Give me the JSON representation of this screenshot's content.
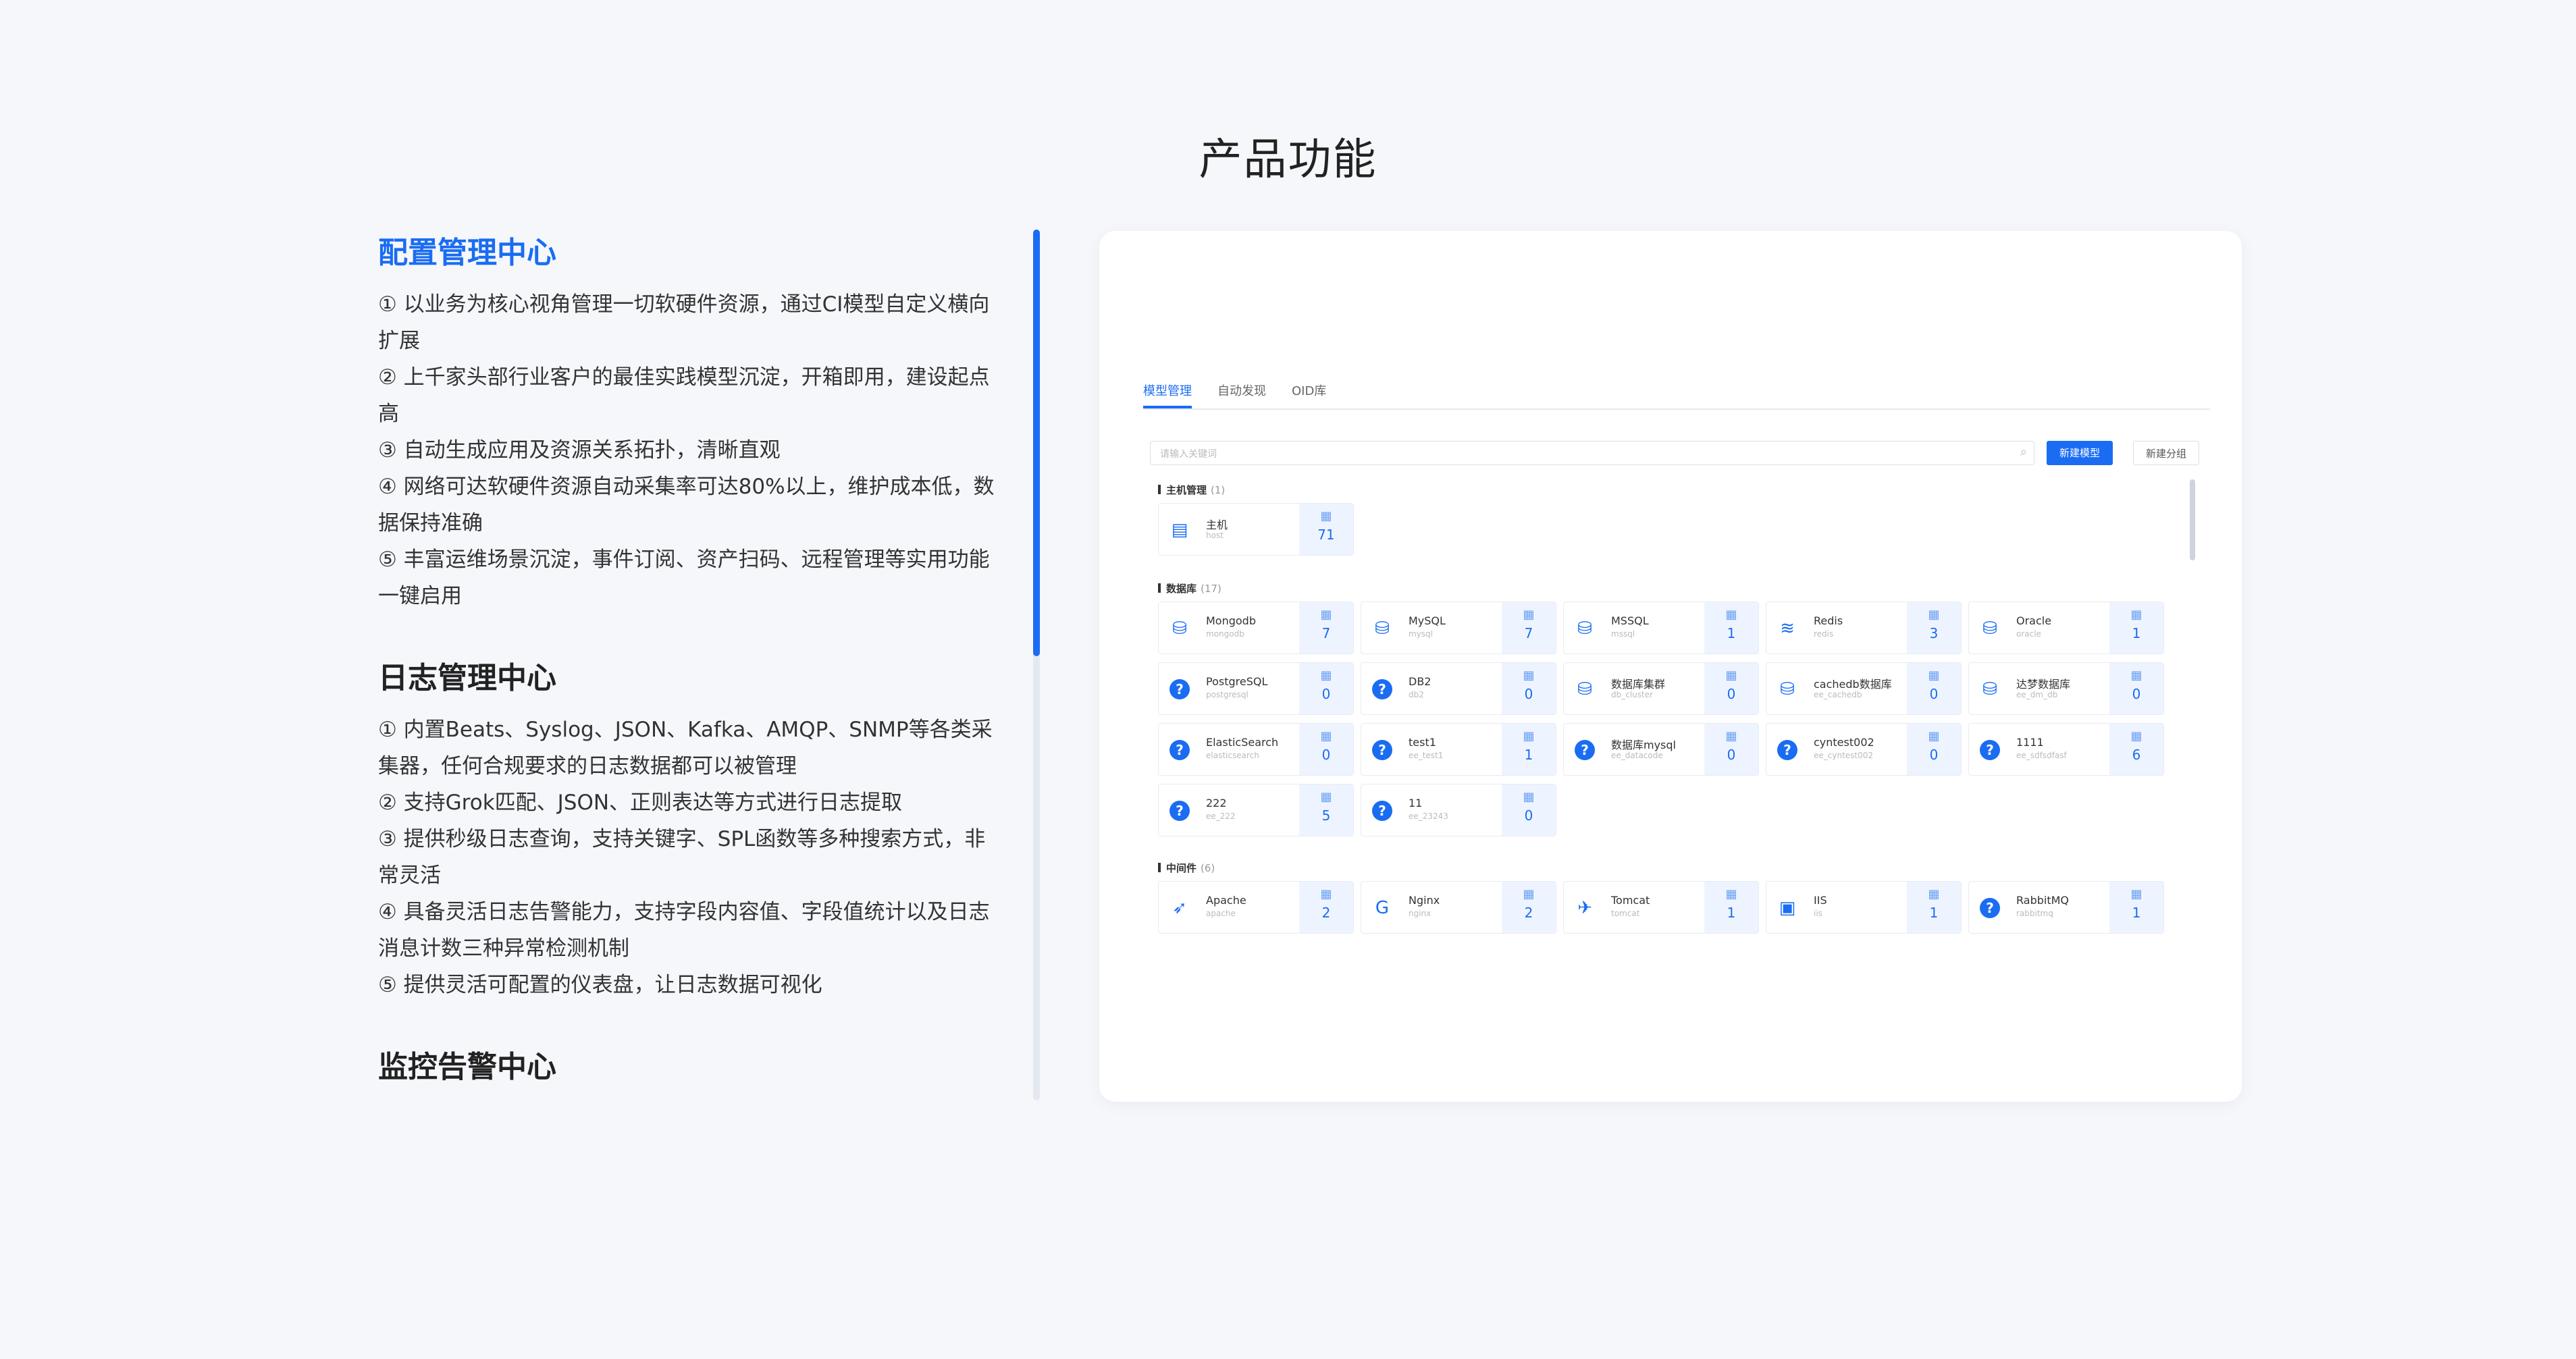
{
  "page": {
    "title": "产品功能"
  },
  "sections": [
    {
      "title": "配置管理中心",
      "lines": [
        "① 以业务为核心视角管理一切软硬件资源，通过CI模型自定义横向",
        "扩展",
        "② 上千家头部行业客户的最佳实践模型沉淀，开箱即用，建设起点",
        "高",
        "③ 自动生成应用及资源关系拓扑，清晰直观",
        "④ 网络可达软硬件资源自动采集率可达80%以上，维护成本低，数",
        "据保持准确",
        "⑤ 丰富运维场景沉淀，事件订阅、资产扫码、远程管理等实用功能",
        "一键启用"
      ]
    },
    {
      "title": "日志管理中心",
      "lines": [
        "① 内置Beats、Syslog、JSON、Kafka、AMQP、SNMP等各类采",
        "集器，任何合规要求的日志数据都可以被管理",
        "② 支持Grok匹配、JSON、正则表达等方式进行日志提取",
        "③ 提供秒级日志查询，支持关键字、SPL函数等多种搜索方式，非",
        "常灵活",
        "④ 具备灵活日志告警能力，支持字段内容值、字段值统计以及日志",
        "消息计数三种异常检测机制",
        "⑤ 提供灵活可配置的仪表盘，让日志数据可视化"
      ]
    },
    {
      "title": "监控告警中心",
      "lines": []
    }
  ],
  "tabs": [
    "模型管理",
    "自动发现",
    "OID库"
  ],
  "search": {
    "placeholder": "请输入关键词"
  },
  "buttons": {
    "new_model": "新建模型",
    "new_group": "新建分组"
  },
  "groups": [
    {
      "name": "主机管理",
      "count": "(1)",
      "items": [
        {
          "name": "主机",
          "sub": "host",
          "n": "71",
          "icon": "server-icon"
        }
      ]
    },
    {
      "name": "数据库",
      "count": "(17)",
      "items": [
        {
          "name": "Mongodb",
          "sub": "mongodb",
          "n": "7",
          "icon": "database-icon"
        },
        {
          "name": "MySQL",
          "sub": "mysql",
          "n": "7",
          "icon": "database-icon"
        },
        {
          "name": "MSSQL",
          "sub": "mssql",
          "n": "1",
          "icon": "database-icon"
        },
        {
          "name": "Redis",
          "sub": "redis",
          "n": "3",
          "icon": "layers-icon"
        },
        {
          "name": "Oracle",
          "sub": "oracle",
          "n": "1",
          "icon": "database-icon"
        },
        {
          "name": "PostgreSQL",
          "sub": "postgresql",
          "n": "0",
          "icon": "question-icon"
        },
        {
          "name": "DB2",
          "sub": "db2",
          "n": "0",
          "icon": "question-icon"
        },
        {
          "name": "数据库集群",
          "sub": "db_cluster",
          "n": "0",
          "icon": "database-icon"
        },
        {
          "name": "cachedb数据库",
          "sub": "ee_cachedb",
          "n": "0",
          "icon": "database-icon"
        },
        {
          "name": "达梦数据库",
          "sub": "ee_dm_db",
          "n": "0",
          "icon": "database-icon"
        },
        {
          "name": "ElasticSearch",
          "sub": "elasticsearch",
          "n": "0",
          "icon": "question-icon"
        },
        {
          "name": "test1",
          "sub": "ee_test1",
          "n": "1",
          "icon": "question-icon"
        },
        {
          "name": "数据库mysql",
          "sub": "ee_datacode",
          "n": "0",
          "icon": "question-icon"
        },
        {
          "name": "cyntest002",
          "sub": "ee_cyntest002",
          "n": "0",
          "icon": "question-icon"
        },
        {
          "name": "1111",
          "sub": "ee_sdfsdfasf",
          "n": "6",
          "icon": "question-icon"
        },
        {
          "name": "222",
          "sub": "ee_222",
          "n": "5",
          "icon": "question-icon"
        },
        {
          "name": "11",
          "sub": "ee_23243",
          "n": "0",
          "icon": "question-icon"
        }
      ]
    },
    {
      "name": "中间件",
      "count": "(6)",
      "items": [
        {
          "name": "Apache",
          "sub": "apache",
          "n": "2",
          "icon": "feather-icon"
        },
        {
          "name": "Nginx",
          "sub": "nginx",
          "n": "2",
          "icon": "nginx-icon"
        },
        {
          "name": "Tomcat",
          "sub": "tomcat",
          "n": "1",
          "icon": "tomcat-icon"
        },
        {
          "name": "IIS",
          "sub": "iis",
          "n": "1",
          "icon": "monitor-icon"
        },
        {
          "name": "RabbitMQ",
          "sub": "rabbitmq",
          "n": "1",
          "icon": "question-icon"
        }
      ]
    }
  ]
}
